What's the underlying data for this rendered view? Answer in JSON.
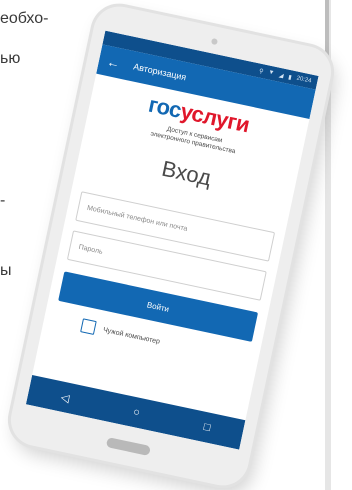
{
  "page_text": {
    "line1": "еобхо-",
    "line2": "ью",
    "line3": "-",
    "line4": "ы"
  },
  "tablet": {
    "status_bar": {
      "time": "20:24",
      "icons": [
        "location-icon",
        "wifi-icon",
        "signal-icon",
        "battery-icon"
      ]
    },
    "toolbar": {
      "title": "Авторизация"
    },
    "brand": {
      "part1": "гос",
      "part2": "услуги"
    },
    "tagline": {
      "line1": "Доступ к сервисам",
      "line2": "электронного правительства"
    },
    "heading": "Вход",
    "phone_placeholder": "Мобильный телефон или почта",
    "password_placeholder": "Пароль",
    "login_button": "Войти",
    "foreign_computer_label": "Чужой компьютер",
    "colors": {
      "accent": "#1268b3",
      "status_bar": "#0e4f8c",
      "brand_red": "#e0172b"
    }
  }
}
